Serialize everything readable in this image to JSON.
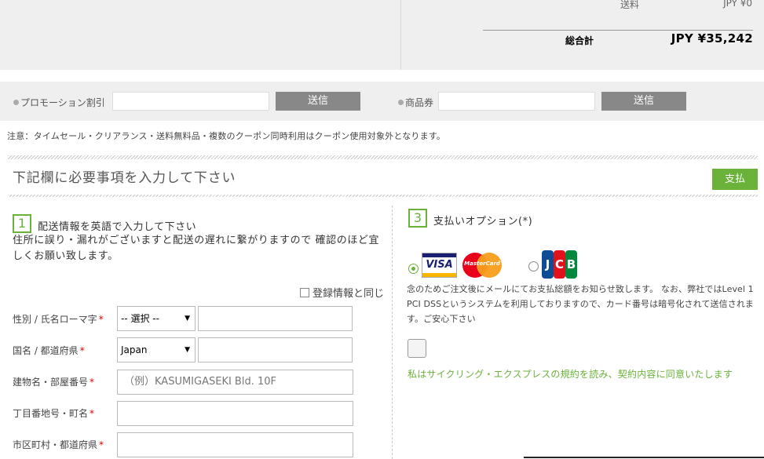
{
  "summary": {
    "shipping_label": "送料",
    "shipping_value": "JPY ¥0",
    "total_label": "総合計",
    "total_value": "JPY ¥35,242"
  },
  "coupon": {
    "promo_label": "プロモーション割引",
    "promo_value": "",
    "promo_button": "送信",
    "voucher_label": "商品券",
    "voucher_value": "",
    "voucher_button": "送信"
  },
  "notice": "注意：タイムセール・クリアランス・送料無料品・複数のクーポン同時利用はクーポン使用対象外となります。",
  "section": {
    "title": "下記欄に必要事項を入力して下さい",
    "pay_button": "支払"
  },
  "shipping_step": {
    "number": "1",
    "title": "配送情報を英語で入力して下さい",
    "description": "住所に誤り・漏れがございますと配送の遅れに繋がりますので 確認のほど宜しくお願い致します。",
    "same_as_registered": "登録情報と同じ"
  },
  "form": {
    "name_label": "性別 / 氏名ローマ字",
    "title_select": "-- 選択 --",
    "name_value": "",
    "country_label": "国名 / 都道府県",
    "country_select": "Japan",
    "prefecture_value": "",
    "building_label": "建物名・部屋番号",
    "building_placeholder": "（例）KASUMIGASEKI Bld. 10F",
    "street_label": "丁目番地号・町名",
    "street_value": "",
    "city_label": "市区町村・都道府県",
    "city_value": "",
    "required_mark": "*"
  },
  "payment_step": {
    "number": "3",
    "title": "支払いオプション(*)",
    "visa_text": "VISA",
    "mastercard_text": "MasterCard",
    "jcb_letters": [
      "J",
      "C",
      "B"
    ],
    "description": "念のためご注文後にメールにてお支払総額をお知らせ致します。 なお、弊社ではLevel 1 PCI DSSというシステムを利用しておりますので、カード番号は暗号化されて送信されます。ご安心下さい",
    "agree_text": "私はサイクリング・エクスプレスの規約を読み、契約内容に同意いたします"
  },
  "colors": {
    "accent": "#6ab23a",
    "button_gray": "#888888",
    "panel_bg": "#efefef",
    "required": "#dd0000"
  }
}
